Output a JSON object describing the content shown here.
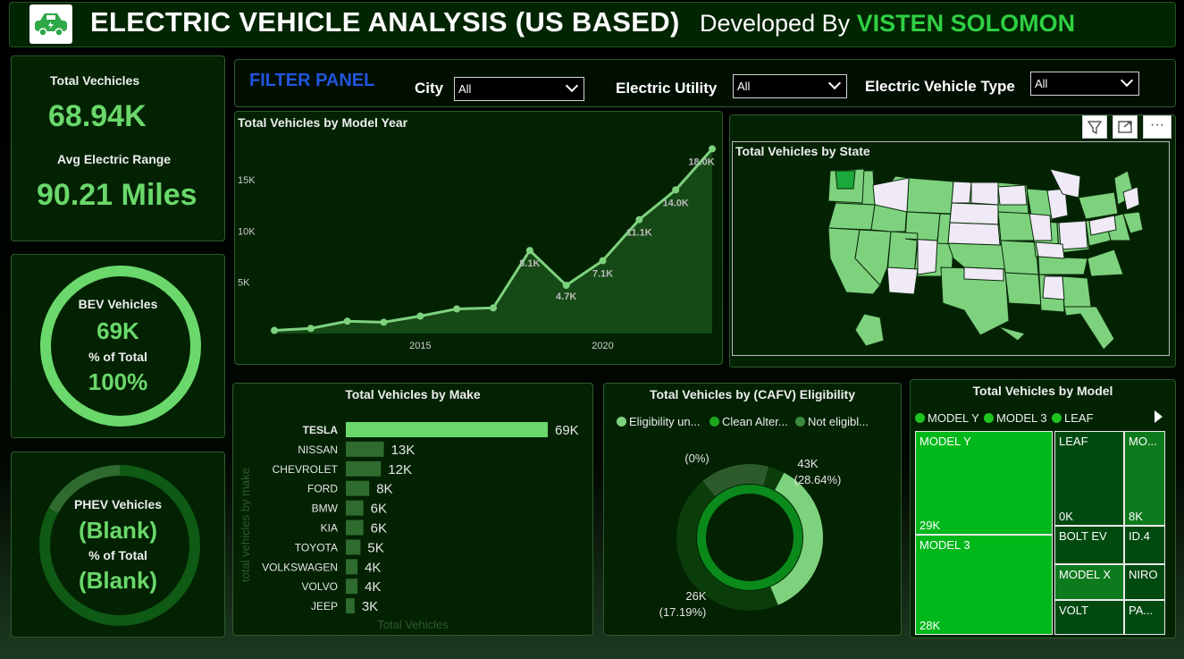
{
  "header": {
    "title": "ELECTRIC VEHICLE ANALYSIS (US BASED)",
    "dev_prefix": "Developed By",
    "dev_name": "VISTEN SOLOMON"
  },
  "kpi": {
    "total_label": "Total Vechicles",
    "total_value": "68.94K",
    "range_label": "Avg Electric Range",
    "range_value": "90.21 Miles"
  },
  "bev": {
    "label": "BEV Vehicles",
    "value": "69K",
    "pct_label": "% of Total",
    "pct_value": "100%",
    "fill": 1.0
  },
  "phev": {
    "label": "PHEV Vehicles",
    "value": "(Blank)",
    "pct_label": "% of Total",
    "pct_value": "(Blank)",
    "fill": 0.0
  },
  "filter": {
    "title": "FILTER PANEL",
    "city_label": "City",
    "city_value": "All",
    "utility_label": "Electric Utility",
    "utility_value": "All",
    "type_label": "Electric Vehicle Type",
    "type_value": "All"
  },
  "colors": {
    "accent": "#6ad86a",
    "panel": "#022202",
    "bright": "#00b81a",
    "dark": "#004a10",
    "mid": "#0e7a1e"
  },
  "line_chart": {
    "title": "Total Vehicles by Model Year",
    "icons": [
      "filter-icon",
      "focus-mode-icon",
      "more-options-icon"
    ]
  },
  "map": {
    "title": "Total Vehicles by State"
  },
  "make_chart": {
    "title": "Total Vehicles by Make",
    "ylabel": "total vehicles by make",
    "xlabel": "Total Vehicles"
  },
  "donut_chart": {
    "title": "Total Vehicles by (CAFV) Eligibility",
    "legend": [
      "Eligibility un...",
      "Clean Alter...",
      "Not eligibl..."
    ]
  },
  "treemap": {
    "title": "Total Vehicles by Model",
    "legend": [
      "MODEL Y",
      "MODEL 3",
      "LEAF"
    ],
    "cells": [
      {
        "label": "MODEL Y",
        "value": "29K"
      },
      {
        "label": "MODEL 3",
        "value": "28K"
      },
      {
        "label": "LEAF",
        "value": "0K"
      },
      {
        "label": "MO...",
        "value": "8K"
      },
      {
        "label": "BOLT EV",
        "value": ""
      },
      {
        "label": "ID.4",
        "value": ""
      },
      {
        "label": "MODEL X",
        "value": ""
      },
      {
        "label": "NIRO",
        "value": ""
      },
      {
        "label": "VOLT",
        "value": ""
      },
      {
        "label": "PA...",
        "value": ""
      }
    ]
  },
  "chart_data": [
    {
      "type": "area",
      "title": "Total Vehicles by Model Year",
      "x": [
        2011,
        2012,
        2013,
        2014,
        2015,
        2016,
        2017,
        2018,
        2019,
        2020,
        2021,
        2022,
        2023
      ],
      "y": [
        0.3,
        0.5,
        1.2,
        1.1,
        1.7,
        2.4,
        2.5,
        8.1,
        4.7,
        7.1,
        11.1,
        14.0,
        18.0
      ],
      "data_labels": [
        "",
        "",
        "",
        "",
        "",
        "",
        "",
        "8.1K",
        "4.7K",
        "7.1K",
        "11.1K",
        "14.0K",
        "18.0K"
      ],
      "yticks": [
        "5K",
        "10K",
        "15K"
      ],
      "xticks": [
        "2015",
        "2020"
      ],
      "ylim": [
        0,
        19
      ]
    },
    {
      "type": "bar",
      "title": "Total Vehicles by Make",
      "categories": [
        "TESLA",
        "NISSAN",
        "CHEVROLET",
        "FORD",
        "BMW",
        "KIA",
        "TOYOTA",
        "VOLKSWAGEN",
        "VOLVO",
        "JEEP"
      ],
      "values": [
        69,
        13,
        12,
        8,
        6,
        6,
        5,
        4,
        4,
        3
      ],
      "labels": [
        "69K",
        "13K",
        "12K",
        "8K",
        "6K",
        "6K",
        "5K",
        "4K",
        "4K",
        "3K"
      ],
      "xlabel": "Total Vehicles",
      "ylabel": "total vehicles by make"
    },
    {
      "type": "pie",
      "title": "Total Vehicles by (CAFV) Eligibility",
      "series": [
        {
          "name": "Eligibility un...",
          "value": 43,
          "label": "43K",
          "pct": "(28.64%)"
        },
        {
          "name": "Clean Alter...",
          "value": 26,
          "label": "26K",
          "pct": "(17.19%)"
        },
        {
          "name": "Not eligibl...",
          "value": 0,
          "label": "",
          "pct": "(0%)"
        }
      ]
    }
  ]
}
